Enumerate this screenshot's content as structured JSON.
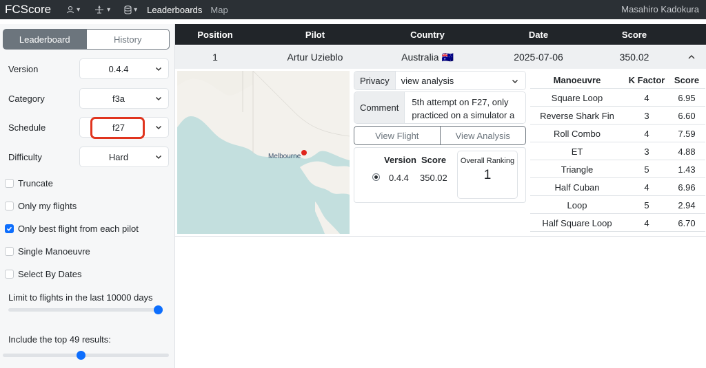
{
  "navbar": {
    "brand": "FCScore",
    "links": [
      "Leaderboards",
      "Map"
    ],
    "user": "Masahiro Kadokura"
  },
  "sidebar": {
    "tabs": [
      "Leaderboard",
      "History"
    ],
    "fields": [
      {
        "label": "Version",
        "value": "0.4.4"
      },
      {
        "label": "Category",
        "value": "f3a"
      },
      {
        "label": "Schedule",
        "value": "f27"
      },
      {
        "label": "Difficulty",
        "value": "Hard"
      }
    ],
    "checks": [
      {
        "label": "Truncate",
        "checked": false
      },
      {
        "label": "Only my flights",
        "checked": false
      },
      {
        "label": "Only best flight from each pilot",
        "checked": true
      },
      {
        "label": "Single Manoeuvre",
        "checked": false
      },
      {
        "label": "Select By Dates",
        "checked": false
      }
    ],
    "limit_label": "Limit to flights in the last 10000 days",
    "limit_fraction": 1.0,
    "top_label": "Include the top 49 results:",
    "top_fraction": 0.47
  },
  "table": {
    "headers": [
      "Position",
      "Pilot",
      "Country",
      "Date",
      "Score"
    ],
    "row": {
      "position": "1",
      "pilot": "Artur Uzieblo",
      "country": "Australia 🇦🇺",
      "date": "2025-07-06",
      "score": "350.02"
    }
  },
  "detail": {
    "map_label": "Melbourne",
    "privacy_label": "Privacy",
    "privacy_value": "view analysis",
    "comment_label": "Comment",
    "comment_text": "5th attempt on F27, only practiced on a simulator a",
    "view_flight": "View Flight",
    "view_analysis": "View Analysis",
    "analysis_headers": [
      "Version",
      "Score"
    ],
    "analysis_row": {
      "version": "0.4.4",
      "score": "350.02"
    },
    "ranking_title": "Overall Ranking",
    "ranking_value": "1"
  },
  "manoeuvres": {
    "headers": [
      "Manoeuvre",
      "K Factor",
      "Score"
    ],
    "rows": [
      {
        "name": "Square Loop",
        "k": "4",
        "score": "6.95"
      },
      {
        "name": "Reverse Shark Fin",
        "k": "3",
        "score": "6.60"
      },
      {
        "name": "Roll Combo",
        "k": "4",
        "score": "7.59"
      },
      {
        "name": "ET",
        "k": "3",
        "score": "4.88"
      },
      {
        "name": "Triangle",
        "k": "5",
        "score": "1.43"
      },
      {
        "name": "Half Cuban",
        "k": "4",
        "score": "6.96"
      },
      {
        "name": "Loop",
        "k": "5",
        "score": "2.94"
      },
      {
        "name": "Half Square Loop",
        "k": "4",
        "score": "6.70"
      }
    ]
  },
  "colors": {
    "navbar": "#2b3035",
    "accent": "#0d6efd",
    "highlight": "#e0341e"
  }
}
